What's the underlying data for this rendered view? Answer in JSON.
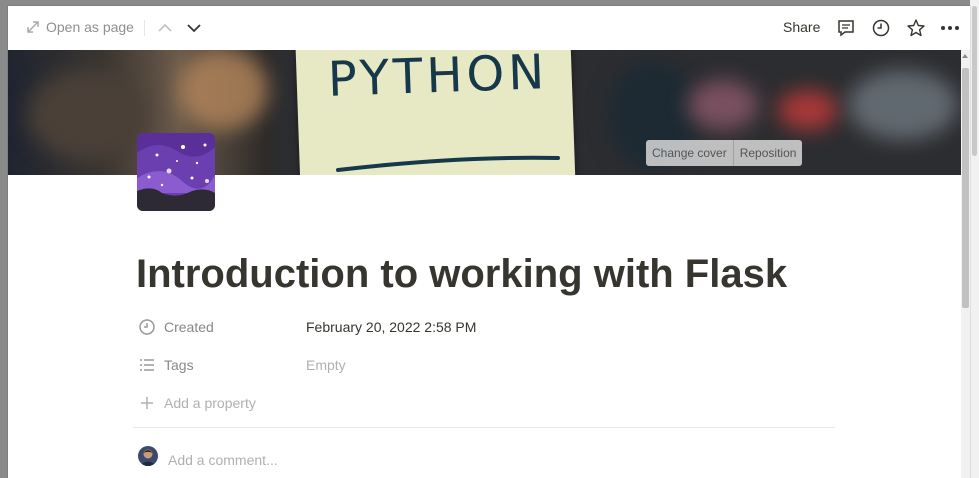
{
  "topbar": {
    "open_as_page": "Open as page",
    "share": "Share",
    "icons": [
      "expand-icon",
      "chevron-up-icon",
      "chevron-down-icon",
      "comment-icon",
      "clock-icon",
      "star-icon",
      "more-icon"
    ]
  },
  "cover": {
    "image_text": "PYTHON",
    "change_cover": "Change cover",
    "reposition": "Reposition"
  },
  "page": {
    "icon": "galaxy-icon",
    "title": "Introduction to working with Flask"
  },
  "properties": [
    {
      "icon": "clock-icon",
      "label": "Created",
      "value": "February 20, 2022 2:58 PM"
    },
    {
      "icon": "list-icon",
      "label": "Tags",
      "value": "Empty"
    }
  ],
  "add_property": "Add a property",
  "comment": {
    "placeholder": "Add a comment..."
  },
  "colors": {
    "text": "#37352f",
    "muted": "#8a8986",
    "placeholder": "#b1b0ad"
  }
}
